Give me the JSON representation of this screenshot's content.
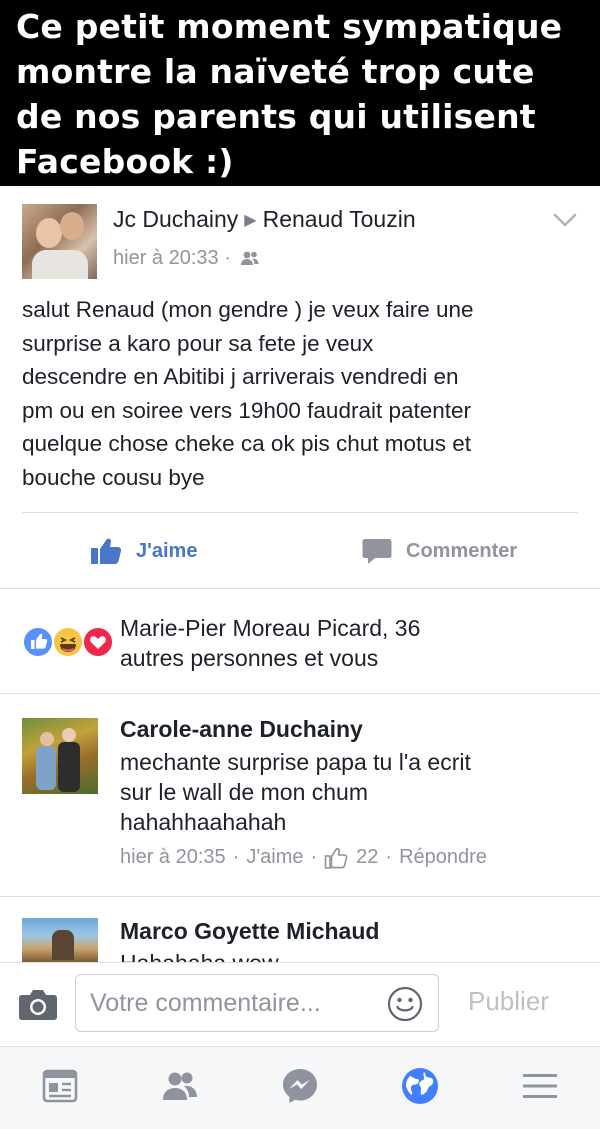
{
  "banner": {
    "text": "Ce petit moment sympatique\nmontre la naïveté trop cute\nde nos parents qui utilisent\nFacebook :)"
  },
  "post": {
    "author": "Jc Duchainy",
    "recipient": "Renaud Touzin",
    "timestamp": "hier à 20:33 ·",
    "audience_icon": "friends-icon",
    "body": "salut Renaud (mon gendre ) je veux faire une\nsurprise a karo pour sa fete je veux\ndescendre en Abitibi j arriverais vendredi en\npm ou en soiree vers 19h00 faudrait patenter\nquelque chose cheke ca ok pis chut  motus et\nbouche cousu bye",
    "actions": {
      "like_label": "J'aime",
      "comment_label": "Commenter"
    },
    "reactions": {
      "icons": [
        "like-reaction-icon",
        "haha-reaction-icon",
        "love-reaction-icon"
      ],
      "summary": "Marie-Pier Moreau Picard, 36\nautres personnes et vous"
    }
  },
  "comments": [
    {
      "author": "Carole-anne Duchainy",
      "text": "mechante surprise papa tu l'a ecrit\nsur le wall de mon chum\nhahahhaahahah",
      "time": "hier à 20:35",
      "like_label": "J'aime",
      "like_count": "22",
      "reply_label": "Répondre"
    },
    {
      "author": "Marco Goyette Michaud",
      "text": "Hahahaha wow"
    }
  ],
  "composer": {
    "placeholder": "Votre commentaire...",
    "publish_label": "Publier"
  },
  "tabbar": {
    "items": [
      "news-feed-icon",
      "friends-tab-icon",
      "messenger-icon",
      "notifications-globe-icon",
      "menu-icon"
    ],
    "active": "notifications-globe-icon"
  },
  "colors": {
    "facebook_blue": "#4a76c9",
    "active_tab": "#4080ff",
    "muted_text": "#90949c",
    "like_reaction": "#5890ff",
    "haha_reaction": "#f7c543",
    "love_reaction": "#f0284a"
  }
}
